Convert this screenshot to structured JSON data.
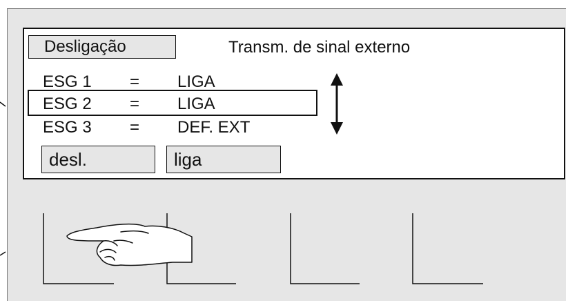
{
  "header": {
    "mode_label": "Desligação",
    "title": "Transm. de sinal externo"
  },
  "rows": [
    {
      "name": "ESG 1",
      "eq": "=",
      "value": "LIGA"
    },
    {
      "name": "ESG 2",
      "eq": "=",
      "value": "LIGA"
    },
    {
      "name": "ESG 3",
      "eq": "=",
      "value": "DEF. EXT"
    }
  ],
  "selected_row": 2,
  "buttons": {
    "off_label": "desl.",
    "on_label": "liga"
  },
  "softkeys": {
    "count": 4
  },
  "icons": {
    "scroll": "up-down-arrow-icon",
    "pointer": "pointing-hand-icon"
  }
}
